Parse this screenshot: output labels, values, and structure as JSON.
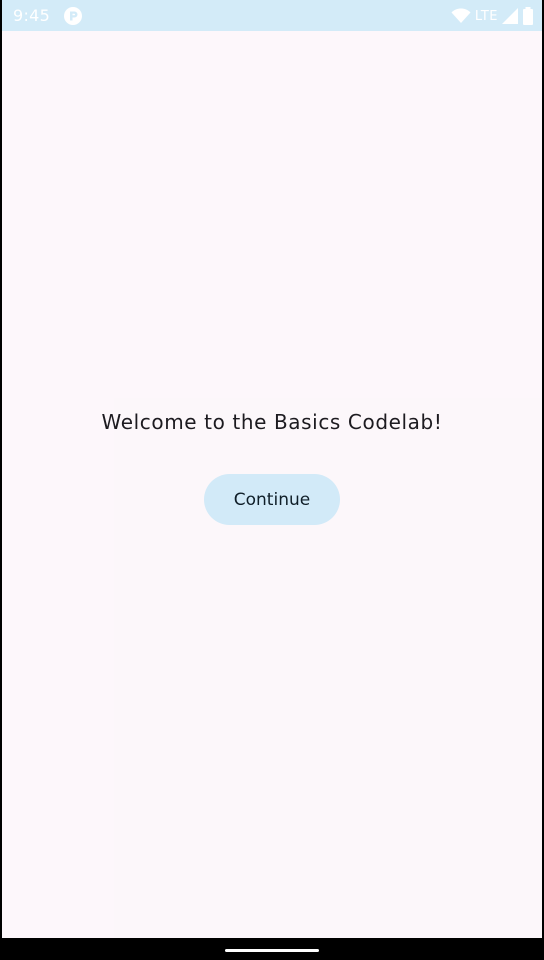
{
  "status_bar": {
    "time": "9:45",
    "network_label": "LTE",
    "icons": [
      "notification-app-icon",
      "wifi-icon",
      "signal-icon",
      "battery-icon"
    ],
    "background_color": "#d3ebf8"
  },
  "main": {
    "welcome_text": "Welcome to the Basics Codelab!",
    "continue_label": "Continue",
    "button_color": "#d2eaf8",
    "background_color": "#fdf7fb"
  },
  "nav_bar": {
    "icons": [
      "home-indicator"
    ]
  }
}
